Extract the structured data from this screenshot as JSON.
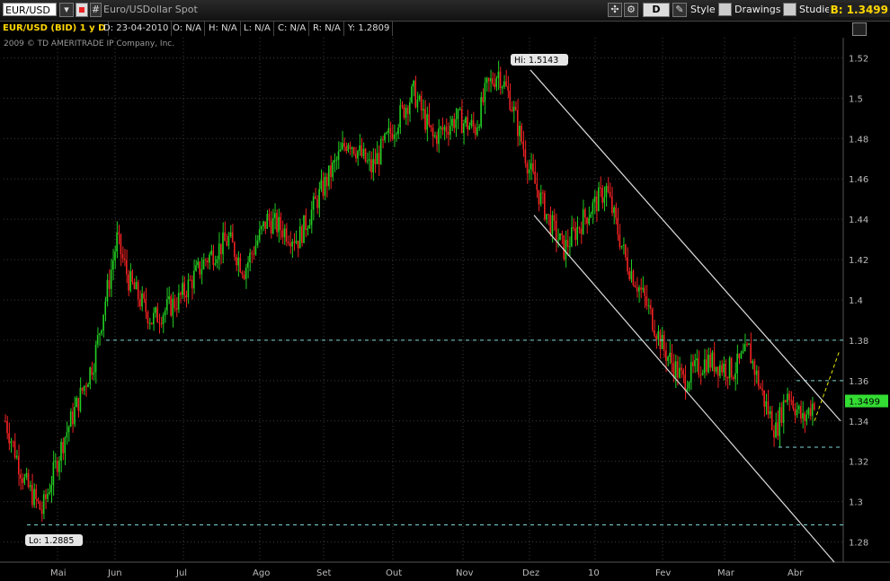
{
  "toolbar": {
    "symbol": "EUR/USD",
    "description": "Euro/USDollar Spot",
    "period_button": "D",
    "style_label": "Style",
    "drawings_label": "Drawings",
    "studies_label": "Studies",
    "bid": "B: 1.3499"
  },
  "infobar": {
    "title": "EUR/USD (BID) 1 y D",
    "date": "D: 23-04-2010",
    "open": "O: N/A",
    "high": "H: N/A",
    "low": "L: N/A",
    "close": "C: N/A",
    "range": "R: N/A",
    "y": "Y: 1.2809"
  },
  "copyright": "2009 © TD AMERITRADE IP Company, Inc.",
  "colors": {
    "up": "#22cc22",
    "down": "#ee2222",
    "grid": "#3a3a3a",
    "level": "#7fd4d4",
    "price_tag": "#33dd33"
  },
  "chart_data": {
    "type": "candlestick",
    "ylim": [
      1.27,
      1.53
    ],
    "y_ticks": [
      "1.52",
      "1.5",
      "1.48",
      "1.46",
      "1.44",
      "1.42",
      "1.4",
      "1.38",
      "1.36",
      "1.34",
      "1.32",
      "1.3",
      "1.28"
    ],
    "x_labels": [
      "Mai",
      "Jun",
      "Jul",
      "Ago",
      "Set",
      "Out",
      "Nov",
      "Dez",
      "10",
      "Fev",
      "Mar",
      "Abr"
    ],
    "high_label": "Hi: 1.5143",
    "low_label": "Lo: 1.2885",
    "last_price": "1.3499",
    "horizontal_levels": [
      1.38,
      1.36,
      1.327,
      1.2885
    ],
    "path": [
      [
        0,
        1.34
      ],
      [
        10,
        1.31
      ],
      [
        19,
        1.295
      ],
      [
        30,
        1.33
      ],
      [
        46,
        1.37
      ],
      [
        58,
        1.43
      ],
      [
        64,
        1.41
      ],
      [
        76,
        1.39
      ],
      [
        90,
        1.4
      ],
      [
        104,
        1.42
      ],
      [
        116,
        1.43
      ],
      [
        124,
        1.415
      ],
      [
        136,
        1.44
      ],
      [
        152,
        1.43
      ],
      [
        162,
        1.45
      ],
      [
        178,
        1.48
      ],
      [
        190,
        1.465
      ],
      [
        204,
        1.49
      ],
      [
        212,
        1.503
      ],
      [
        222,
        1.48
      ],
      [
        234,
        1.49
      ],
      [
        244,
        1.485
      ],
      [
        250,
        1.505
      ],
      [
        256,
        1.513
      ],
      [
        262,
        1.5
      ],
      [
        272,
        1.465
      ],
      [
        282,
        1.44
      ],
      [
        290,
        1.425
      ],
      [
        300,
        1.44
      ],
      [
        312,
        1.455
      ],
      [
        322,
        1.42
      ],
      [
        332,
        1.4
      ],
      [
        342,
        1.375
      ],
      [
        352,
        1.36
      ],
      [
        364,
        1.37
      ],
      [
        378,
        1.365
      ],
      [
        386,
        1.375
      ],
      [
        394,
        1.35
      ],
      [
        400,
        1.335
      ],
      [
        406,
        1.355
      ],
      [
        414,
        1.34
      ],
      [
        420,
        1.35
      ]
    ]
  }
}
